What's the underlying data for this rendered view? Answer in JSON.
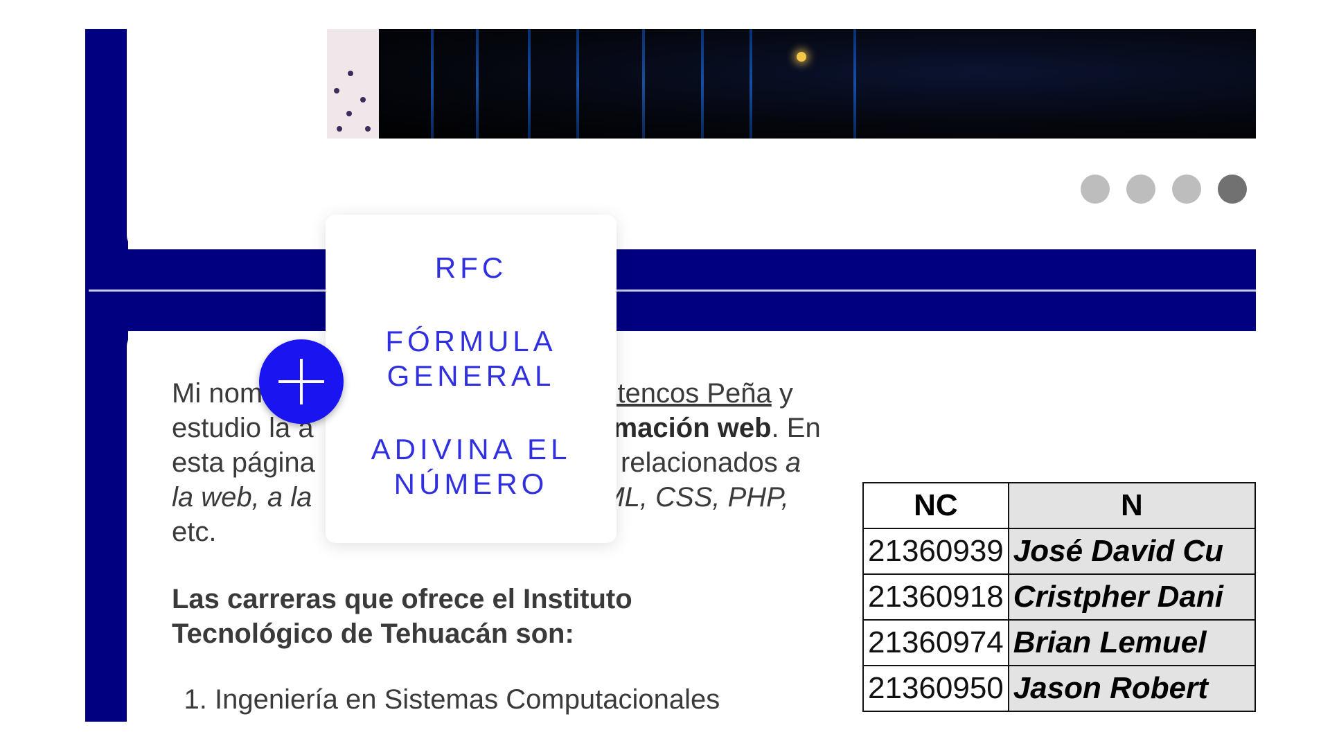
{
  "carousel": {
    "slide_count": 4,
    "active_index": 3
  },
  "intro": {
    "name_prefix": "Mi nom",
    "name_link": "utencos Peña",
    "after_name": " y",
    "line2_start": "estudio la a",
    "bold_text": "mación web",
    "line2_end": ". En",
    "line3_start": "esta página",
    "line3_mid": " relacionados ",
    "line3_em": "a",
    "line4_em_start": "la web, a la",
    "line4_em_end": "ML, CSS, PHP,",
    "line5": "etc."
  },
  "careers": {
    "title": "Las carreras que ofrece el Instituto Tecnológico de Tehuacán son:",
    "items": [
      "Ingeniería en Sistemas Computacionales"
    ]
  },
  "menu": {
    "items": [
      "RFC",
      "FÓRMULA GENERAL",
      "ADIVINA EL NÚMERO"
    ]
  },
  "table": {
    "headers": [
      "NC",
      "N"
    ],
    "rows": [
      {
        "nc": "21360939",
        "name": "José David Cu"
      },
      {
        "nc": "21360918",
        "name": "Cristpher Dani"
      },
      {
        "nc": "21360974",
        "name": "Brian Lemuel"
      },
      {
        "nc": "21360950",
        "name": "Jason Robert"
      }
    ]
  },
  "colors": {
    "navy": "#000080",
    "accent_blue": "#1a14f0",
    "menu_text": "#3030e0"
  },
  "icons": {
    "fab": "plus-icon"
  }
}
